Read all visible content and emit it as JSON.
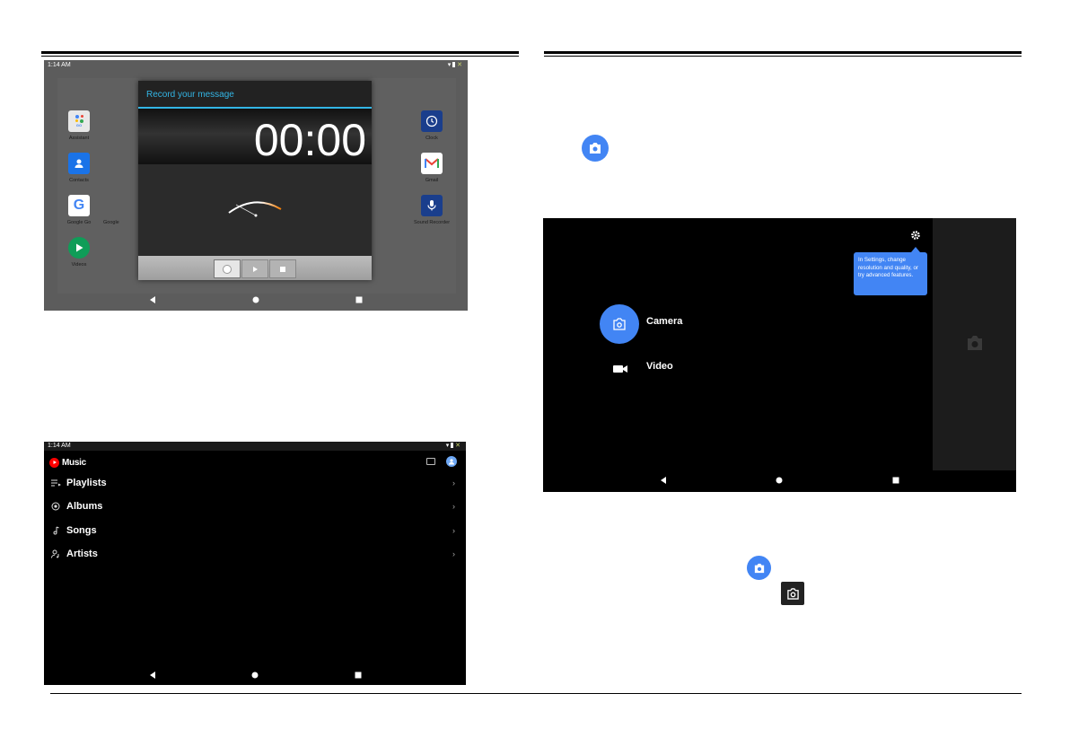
{
  "recorder": {
    "status_time": "1:14 AM",
    "dialog_title": "Record your message",
    "timer": "00:00",
    "apps_left": [
      "Assistant",
      "Contacts",
      "Google Go",
      "Videos"
    ],
    "apps_left_partial": "Google",
    "apps_right": [
      "Clock",
      "Gmail",
      "Sound Recorder"
    ],
    "assistant_badge": "GO"
  },
  "music": {
    "status_time": "1:14 AM",
    "app_title": "Music",
    "items": [
      {
        "label": "Playlists",
        "icon": "playlist-icon"
      },
      {
        "label": "Albums",
        "icon": "album-icon"
      },
      {
        "label": "Songs",
        "icon": "music-note-icon"
      },
      {
        "label": "Artists",
        "icon": "artist-icon"
      }
    ]
  },
  "camera": {
    "tooltip": "In Settings, change resolution and quality, or try advanced features.",
    "modes": [
      {
        "label": "Camera",
        "icon": "camera-icon"
      },
      {
        "label": "Video",
        "icon": "videocam-icon"
      }
    ]
  },
  "colors": {
    "accent_blue": "#4285f4",
    "recorder_teal": "#33b5e5",
    "youtube_red": "#ff0000"
  }
}
